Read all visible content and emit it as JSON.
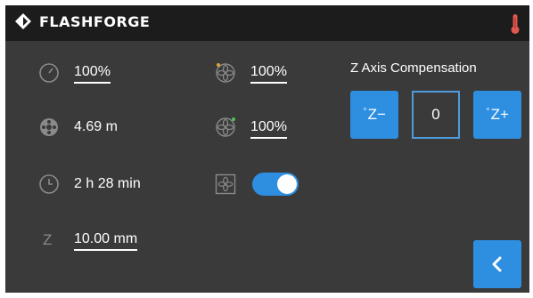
{
  "header": {
    "brand": "FLASHFORGE",
    "logo_icon": "flashforge-logo-icon",
    "temperature_icon": "thermometer-icon",
    "accent": "#e0584f"
  },
  "status": {
    "speed": "100%",
    "filament_used": "4.69 m",
    "time_remaining": "2 h 28 min",
    "z_label": "Z",
    "z_height": "10.00 mm",
    "fan1_speed": "100%",
    "fan2_speed": "100%",
    "case_fan_toggle_on": true
  },
  "z_compensation": {
    "title": "Z Axis Compensation",
    "minus_prefix": "+",
    "minus_label": "Z−",
    "value": "0",
    "plus_prefix": "+",
    "plus_label": "Z+"
  },
  "navigation": {
    "back_icon": "chevron-left-icon"
  },
  "colors": {
    "background": "#3a3a3a",
    "topbar": "#1c1c1c",
    "accent_blue": "#2e8ee0",
    "icon_gray": "#8a8a8a"
  }
}
